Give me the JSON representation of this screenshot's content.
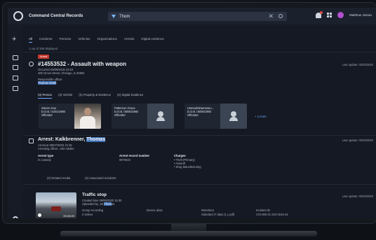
{
  "app": {
    "title": "Command Central Records"
  },
  "search": {
    "value": "Thom"
  },
  "user": {
    "name": "Matthew, Moran"
  },
  "tabs": [
    "All",
    "Incidents",
    "Persons",
    "Vehicles",
    "Organizations",
    "Arrests",
    "Digital evidence"
  ],
  "results_count": "1 out of 305 displayed",
  "incident": {
    "badge": "Arrest",
    "title": "#14553532 - Assault with weapon",
    "occurred": "Occurred 03/09/2019 10:48",
    "address": "405 Grove Street, Chicago, IL 60594",
    "officer_label": "Responsible officer",
    "officer_name": "Thomas Smith",
    "last_update": "Last update: 03/02/2020",
    "subtabs": [
      "(4) Person",
      "(4) Vehicle",
      "(3) Property & Evidence",
      "(2) Digital Evidence"
    ],
    "persons": [
      {
        "name": "Steven Kao",
        "dob": "D.O.B. 01/01/1980",
        "role": "Offender"
      },
      {
        "name": "Patterson Grace",
        "dob": "D.O.B. 05/05/1980",
        "role": "Offender"
      },
      {
        "name": "Usmaulrahamaneu...",
        "dob": "D.O.B. 05/05/1980",
        "role": "Offender"
      }
    ],
    "more": "+ 2 more"
  },
  "arrest": {
    "title_prefix": "Arrest: Kalkbrenner, ",
    "title_hl": "Thomas",
    "arrest_at": "Arrest at 09/07/2020 12:45",
    "officer": "Arresting officer, John Muller",
    "last_update": "Last update: 03/02/2020",
    "col1_h": "Arrest type",
    "col1_v": "In custody",
    "col2_h": "Arrest record number",
    "col2_v": "0876543",
    "col3_h": "Charges",
    "charges": [
      "• Theft (Primary)",
      "• Assault",
      "• Drug Manufacturing"
    ],
    "links": [
      "(3) Related media",
      "(2) Associated Incidents"
    ]
  },
  "media": {
    "title": "Traffic stop",
    "created": "Created time 09/08/2020 15:30",
    "uploaded_prefix": "Uploaded by, Jet ",
    "uploaded_hl": "Thom",
    "uploaded_suffix": "as",
    "duration": "00:49:20",
    "col1_h": "Group recording",
    "col1_v": "2 videos",
    "col2_h": "Device alias",
    "col3_h": "Retention",
    "col3_v": "Standard (7 days (1 y pdf)",
    "col4_h": "Incident ID",
    "col4_v": "CSI-060-21-324-2016-24",
    "last_update": "Last update: 03/02/2020"
  }
}
